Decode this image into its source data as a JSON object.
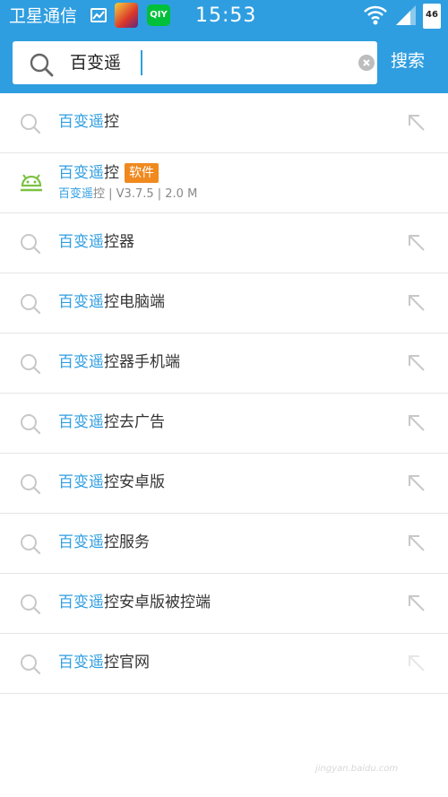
{
  "status_bar": {
    "carrier": "卫星通信",
    "time": "15:53",
    "network": "46",
    "icons": [
      "gallery-icon",
      "game-app-icon",
      "iqiyi-icon",
      "wifi-icon",
      "signal-icon",
      "battery-icon"
    ],
    "iqiyi_label": "QIY"
  },
  "search": {
    "query": "百变遥",
    "button_label": "搜索"
  },
  "app_result": {
    "highlight": "百变遥",
    "rest": "控",
    "badge": "软件",
    "meta_highlight": "百变遥",
    "meta_rest": "控 | V3.7.5 | 2.0 M"
  },
  "suggestions": [
    {
      "highlight": "百变遥",
      "rest": "控"
    },
    {
      "highlight": "百变遥",
      "rest": "控器"
    },
    {
      "highlight": "百变遥",
      "rest": "控电脑端"
    },
    {
      "highlight": "百变遥",
      "rest": "控器手机端"
    },
    {
      "highlight": "百变遥",
      "rest": "控去广告"
    },
    {
      "highlight": "百变遥",
      "rest": "控安卓版"
    },
    {
      "highlight": "百变遥",
      "rest": "控服务"
    },
    {
      "highlight": "百变遥",
      "rest": "控安卓版被控端"
    },
    {
      "highlight": "百变遥",
      "rest": "控官网"
    }
  ],
  "colors": {
    "accent": "#2f9ee0",
    "badge": "#f0891e",
    "android_green": "#7cc142"
  },
  "watermark": "jingyan.baidu.com"
}
